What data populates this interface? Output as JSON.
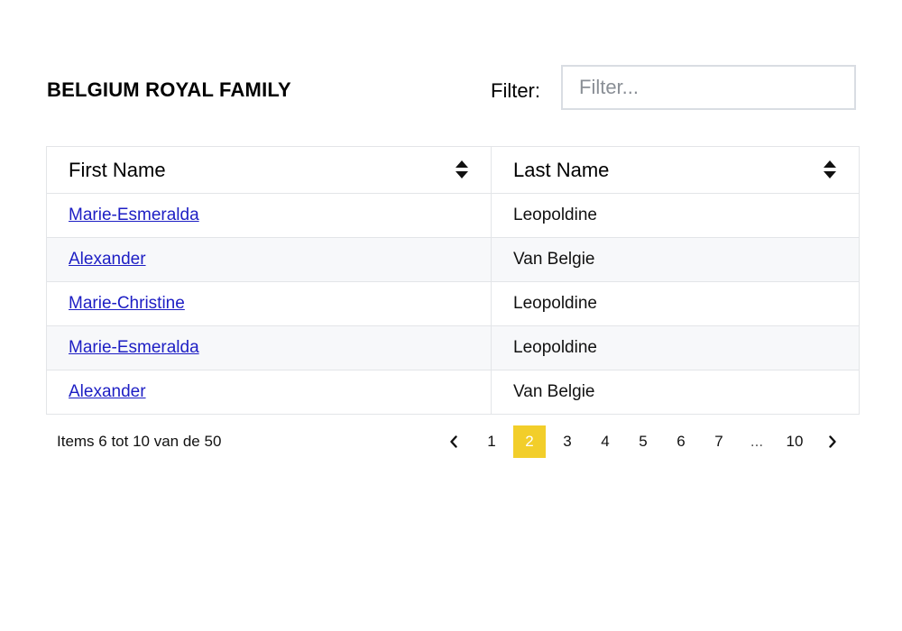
{
  "header": {
    "title": "BELGIUM ROYAL FAMILY",
    "filter_label": "Filter:",
    "filter_placeholder": "Filter...",
    "filter_value": ""
  },
  "table": {
    "columns": [
      {
        "label": "First Name",
        "sort_icon": "sort-icon"
      },
      {
        "label": "Last Name",
        "sort_icon": "sort-icon"
      }
    ],
    "rows": [
      {
        "first_name": "Marie-Esmeralda",
        "last_name": "Leopoldine"
      },
      {
        "first_name": "Alexander",
        "last_name": "Van Belgie"
      },
      {
        "first_name": "Marie-Christine",
        "last_name": "Leopoldine"
      },
      {
        "first_name": "Marie-Esmeralda",
        "last_name": "Leopoldine"
      },
      {
        "first_name": "Alexander",
        "last_name": "Van Belgie"
      }
    ]
  },
  "footer": {
    "items_info": "Items 6 tot 10 van de 50"
  },
  "pagination": {
    "prev_icon": "chevron-left-icon",
    "next_icon": "chevron-right-icon",
    "pages": [
      "1",
      "2",
      "3",
      "4",
      "5",
      "6",
      "7",
      "...",
      "10"
    ],
    "current": "2"
  },
  "colors": {
    "accent": "#f2ce2a",
    "link": "#1d1ec4",
    "border": "#e3e5e8",
    "row_alt": "#f7f8fa"
  }
}
